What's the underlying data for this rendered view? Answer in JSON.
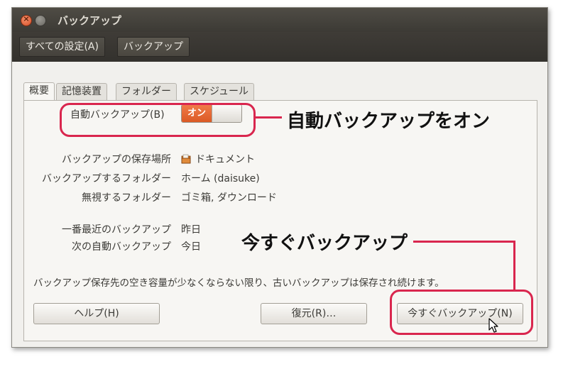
{
  "window": {
    "title": "バックアップ"
  },
  "toolbar": {
    "all_settings": "すべての設定(A)",
    "current": "バックアップ"
  },
  "tabs": [
    {
      "label": "概要",
      "active": true
    },
    {
      "label": "記憶装置",
      "active": false
    },
    {
      "label": "フォルダー",
      "active": false
    },
    {
      "label": "スケジュール",
      "active": false
    }
  ],
  "overview": {
    "auto_backup_label": "自動バックアップ(B)",
    "auto_backup_state": "オン",
    "storage_location_label": "バックアップの保存場所",
    "storage_location_value": "ドキュメント",
    "folders_label": "バックアップするフォルダー",
    "folders_value": "ホーム (daisuke)",
    "ignored_label": "無視するフォルダー",
    "ignored_value": "ゴミ箱, ダウンロード",
    "last_backup_label": "一番最近のバックアップ",
    "last_backup_value": "昨日",
    "next_backup_label": "次の自動バックアップ",
    "next_backup_value": "今日",
    "note": "バックアップ保存先の空き容量が少なくならない限り、古いバックアップは保存され続けます。"
  },
  "buttons": {
    "help": "ヘルプ(H)",
    "restore": "復元(R)…",
    "backup_now": "今すぐバックアップ(N)"
  },
  "annotations": {
    "auto_backup_on": "自動バックアップをオン",
    "backup_now": "今すぐバックアップ"
  },
  "colors": {
    "accent": "#db5a25",
    "annotation": "#d9264e",
    "titlebar": "#3c3a35"
  },
  "icons": {
    "close": "close-icon",
    "minimize": "minimize-icon",
    "folder": "folder-icon",
    "cursor": "mouse-pointer-icon"
  }
}
